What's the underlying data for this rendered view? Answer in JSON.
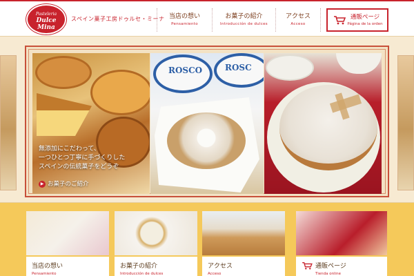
{
  "header": {
    "logo": {
      "small": "Pasteleria",
      "main": "Dulce Mina"
    },
    "tagline": "スペイン菓子工房ドゥルセ・ミーナ",
    "nav": [
      {
        "jp": "当店の想い",
        "es": "Pensamiento"
      },
      {
        "jp": "お菓子の紹介",
        "es": "Introducción de dulces"
      },
      {
        "jp": "アクセス",
        "es": "Acceso"
      }
    ],
    "order": {
      "jp": "通販ページ",
      "es": "Página de la orden"
    }
  },
  "hero": {
    "wrapper_text_1": "ROSCO",
    "wrapper_text_2": "ROSC",
    "caption_lines": [
      "無添加にこだわって、",
      "一つひとつ丁寧に手づくりした",
      "スペインの伝統菓子をどうぞ"
    ],
    "link_label": "お菓子のご紹介"
  },
  "cards": [
    {
      "jp": "当店の想い",
      "es": "Pensamiento"
    },
    {
      "jp": "お菓子の紹介",
      "es": "Introducción de dulces"
    },
    {
      "jp": "アクセス",
      "es": "Acceso"
    },
    {
      "jp": "通販ページ",
      "es": "Tienda online"
    }
  ],
  "colors": {
    "accent": "#c8222c",
    "background": "#f5c95a",
    "hero_bg": "#f7ead2"
  },
  "icons": [
    "cart-icon",
    "arrow-icon"
  ]
}
